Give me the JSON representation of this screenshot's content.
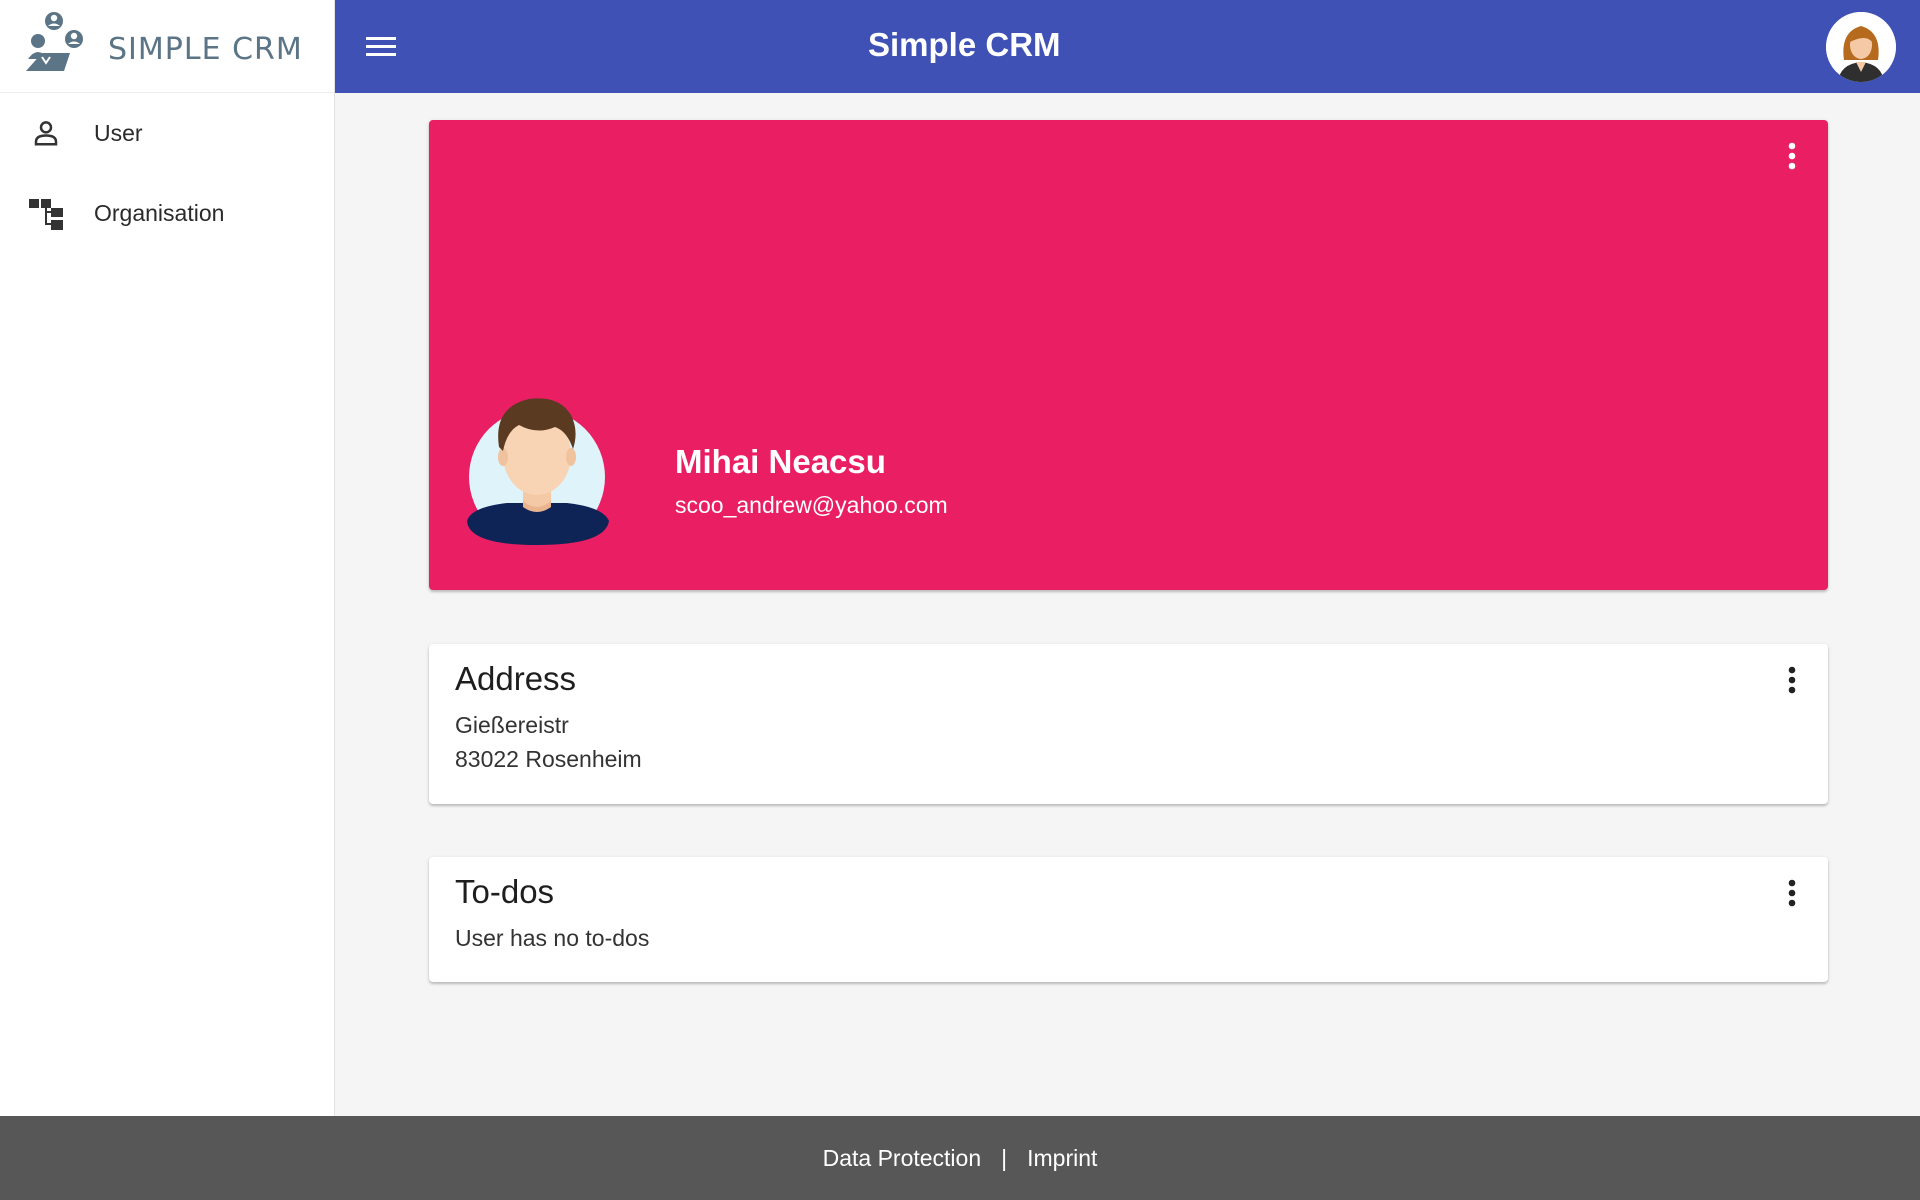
{
  "app": {
    "brand_name": "SIMPLE CRM",
    "title": "Simple CRM"
  },
  "sidebar": {
    "items": [
      {
        "label": "User",
        "icon": "person-icon"
      },
      {
        "label": "Organisation",
        "icon": "org-chart-icon"
      }
    ]
  },
  "profile": {
    "name": "Mihai Neacsu",
    "email": "scoo_andrew@yahoo.com"
  },
  "address": {
    "title": "Address",
    "street": "Gießereistr",
    "city_line": "83022 Rosenheim"
  },
  "todos": {
    "title": "To-dos",
    "empty_text": "User has no to-dos"
  },
  "footer": {
    "data_protection": "Data Protection",
    "separator": "|",
    "imprint": "Imprint"
  },
  "colors": {
    "topbar": "#3f51b5",
    "hero": "#e91e63",
    "footer": "#575757"
  }
}
